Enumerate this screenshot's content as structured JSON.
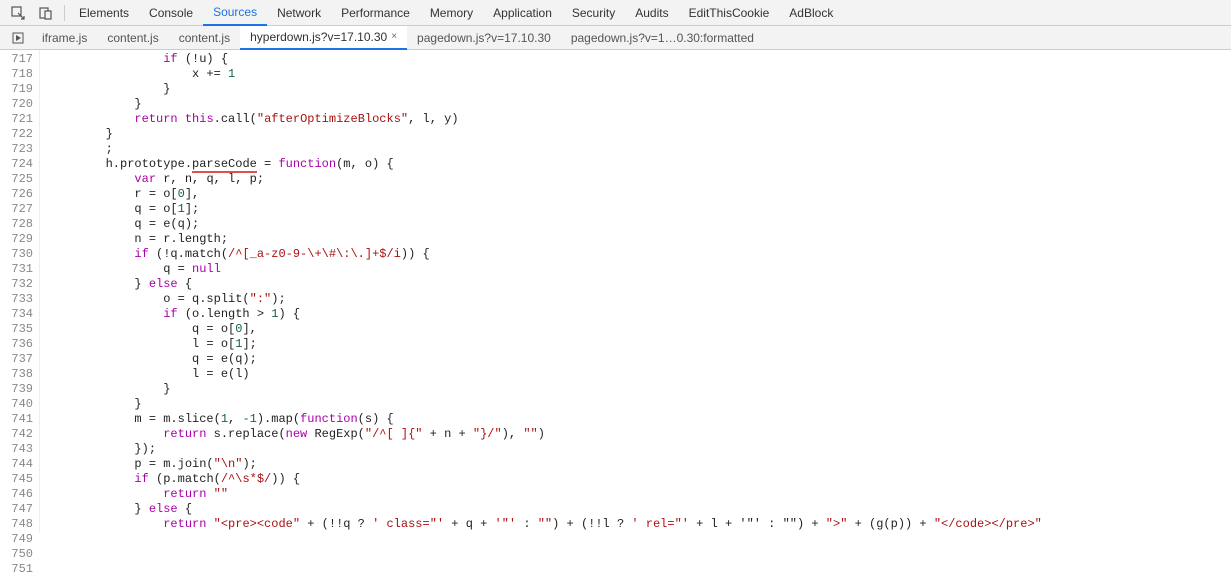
{
  "toolbar": {
    "tabs": [
      "Elements",
      "Console",
      "Sources",
      "Network",
      "Performance",
      "Memory",
      "Application",
      "Security",
      "Audits",
      "EditThisCookie",
      "AdBlock"
    ],
    "activeTab": "Sources"
  },
  "fileTabs": {
    "items": [
      {
        "label": "iframe.js",
        "active": false,
        "closeable": false
      },
      {
        "label": "content.js",
        "active": false,
        "closeable": false
      },
      {
        "label": "content.js",
        "active": false,
        "closeable": false
      },
      {
        "label": "hyperdown.js?v=17.10.30",
        "active": true,
        "closeable": true
      },
      {
        "label": "pagedown.js?v=17.10.30",
        "active": false,
        "closeable": false
      },
      {
        "label": "pagedown.js?v=1…0.30:formatted",
        "active": false,
        "closeable": false
      }
    ]
  },
  "gutter": {
    "start": 717,
    "end": 751
  },
  "code": {
    "lines": [
      {
        "i": 0,
        "t": "                if (!u) {",
        "p": [
          "kw:if"
        ]
      },
      {
        "i": 1,
        "t": "                    x += 1",
        "p": [
          "num:1"
        ]
      },
      {
        "i": 2,
        "t": "                }"
      },
      {
        "i": 3,
        "t": "            }"
      },
      {
        "i": 4,
        "t": "            return this.call(\"afterOptimizeBlocks\", l, y)",
        "p": [
          "kw:return",
          "kw:this",
          "str:\"afterOptimizeBlocks\""
        ]
      },
      {
        "i": 5,
        "t": "        }"
      },
      {
        "i": 6,
        "t": "        ;"
      },
      {
        "i": 7,
        "t": "        h.prototype.parseCode = function(m, o) {",
        "p": [
          "kw:function",
          "ul:parseCode"
        ]
      },
      {
        "i": 8,
        "t": "            var r, n, q, l, p;",
        "p": [
          "kw:var"
        ]
      },
      {
        "i": 9,
        "t": "            r = o[0],",
        "p": [
          "num:0"
        ]
      },
      {
        "i": 10,
        "t": "            q = o[1];",
        "p": [
          "num:1"
        ]
      },
      {
        "i": 11,
        "t": "            q = e(q);"
      },
      {
        "i": 12,
        "t": "            n = r.length;"
      },
      {
        "i": 13,
        "t": "            if (!q.match(/^[_a-z0-9-\\+\\#\\:\\.]+$/i)) {",
        "p": [
          "kw:if",
          "regex:/^[_a-z0-9-\\+\\#\\:\\.]+$/i"
        ]
      },
      {
        "i": 14,
        "t": "                q = null",
        "p": [
          "kw:null"
        ]
      },
      {
        "i": 15,
        "t": "            } else {",
        "p": [
          "kw:else"
        ]
      },
      {
        "i": 16,
        "t": "                o = q.split(\":\");",
        "p": [
          "str:\":\""
        ]
      },
      {
        "i": 17,
        "t": "                if (o.length > 1) {",
        "p": [
          "kw:if",
          "num:1"
        ]
      },
      {
        "i": 18,
        "t": "                    q = o[0],",
        "p": [
          "num:0"
        ]
      },
      {
        "i": 19,
        "t": "                    l = o[1];",
        "p": [
          "num:1"
        ]
      },
      {
        "i": 20,
        "t": "                    q = e(q);"
      },
      {
        "i": 21,
        "t": "                    l = e(l)"
      },
      {
        "i": 22,
        "t": "                }"
      },
      {
        "i": 23,
        "t": "            }"
      },
      {
        "i": 24,
        "t": "            m = m.slice(1, -1).map(function(s) {",
        "p": [
          "num:1",
          "num:-1",
          "kw:function"
        ]
      },
      {
        "i": 25,
        "t": "                return s.replace(new RegExp(\"/^[ ]{\" + n + \"}/\"), \"\")",
        "p": [
          "kw:return",
          "kw:new",
          "str:\"/^[ ]{\"",
          "str:\"}/\"",
          "str:\"\""
        ]
      },
      {
        "i": 26,
        "t": "            });"
      },
      {
        "i": 27,
        "t": "            p = m.join(\"\\n\");",
        "p": [
          "str:\"\\n\""
        ]
      },
      {
        "i": 28,
        "t": "            if (p.match(/^\\s*$/)) {",
        "p": [
          "kw:if",
          "regex:/^\\s*$/"
        ]
      },
      {
        "i": 29,
        "t": "                return \"\"",
        "p": [
          "kw:return",
          "str:\"\""
        ]
      },
      {
        "i": 30,
        "t": "            } else {",
        "p": [
          "kw:else"
        ]
      },
      {
        "i": 31,
        "t": "                return \"<pre><code\" + (!!q ? ' class=\"' + q + '\"' : \"\") + (!!l ? ' rel=\"' + l + '\"' : \"\") + \">\" + (g(p)) + \"</code></pre>\"",
        "p": [
          "kw:return",
          "str:\"<pre><code\"",
          "str:' class=\"'",
          "str:'\"'",
          "str:\"\"",
          "str:' rel=\"'",
          "str:'\"'",
          "str:\">\"",
          "str:\"</code></pre>\""
        ]
      },
      {
        "i": 32,
        "t": "            }"
      },
      {
        "i": 33,
        "t": "        }"
      },
      {
        "i": 34,
        "t": "        ;"
      }
    ]
  }
}
